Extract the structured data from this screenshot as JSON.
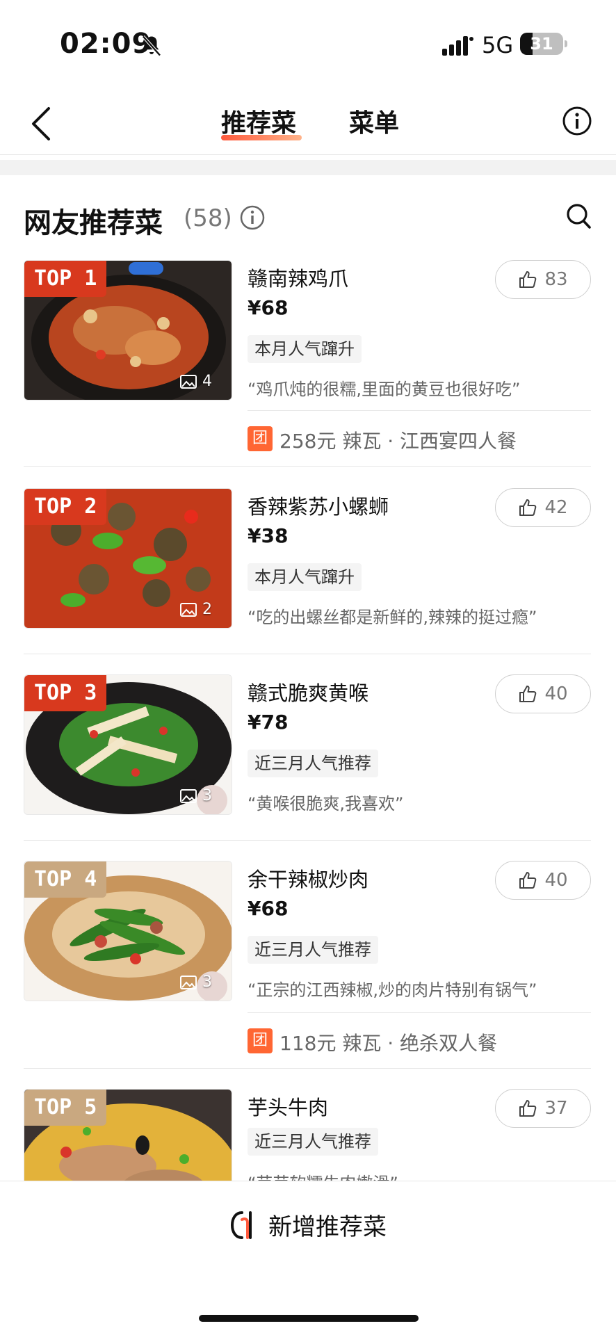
{
  "status": {
    "time": "02:09",
    "network": "5G",
    "battery": "31"
  },
  "nav": {
    "tabs": [
      "推荐菜",
      "菜单"
    ],
    "active_tab": 0
  },
  "section": {
    "title": "网友推荐菜",
    "count": "(58)"
  },
  "dishes": [
    {
      "rank": "TOP 1",
      "name": "赣南辣鸡爪",
      "price": "¥68",
      "tag": "本月人气蹿升",
      "quote": "“鸡爪炖的很糯,里面的黄豆也很好吃”",
      "likes": "83",
      "pics": "4",
      "group": {
        "badge": "团",
        "text": "258元 辣瓦 · 江西宴四人餐"
      }
    },
    {
      "rank": "TOP 2",
      "name": "香辣紫苏小螺蛳",
      "price": "¥38",
      "tag": "本月人气蹿升",
      "quote": "“吃的出螺丝都是新鲜的,辣辣的挺过瘾”",
      "likes": "42",
      "pics": "2"
    },
    {
      "rank": "TOP 3",
      "name": "赣式脆爽黄喉",
      "price": "¥78",
      "tag": "近三月人气推荐",
      "quote": "“黄喉很脆爽,我喜欢”",
      "likes": "40",
      "pics": "3"
    },
    {
      "rank": "TOP 4",
      "name": "余干辣椒炒肉",
      "price": "¥68",
      "tag": "近三月人气推荐",
      "quote": "“正宗的江西辣椒,炒的肉片特别有锅气”",
      "likes": "40",
      "pics": "3",
      "group": {
        "badge": "团",
        "text": "118元 辣瓦 · 绝杀双人餐"
      }
    },
    {
      "rank": "TOP 5",
      "name": "芋头牛肉",
      "tag": "近三月人气推荐",
      "quote": "“芋芋软糯牛肉嫩滑”",
      "likes": "37"
    }
  ],
  "bottom": {
    "add_label": "新增推荐菜"
  },
  "colors": {
    "accent": "#d8391e",
    "badge_tan": "#c9a880",
    "group": "#ff6633"
  }
}
